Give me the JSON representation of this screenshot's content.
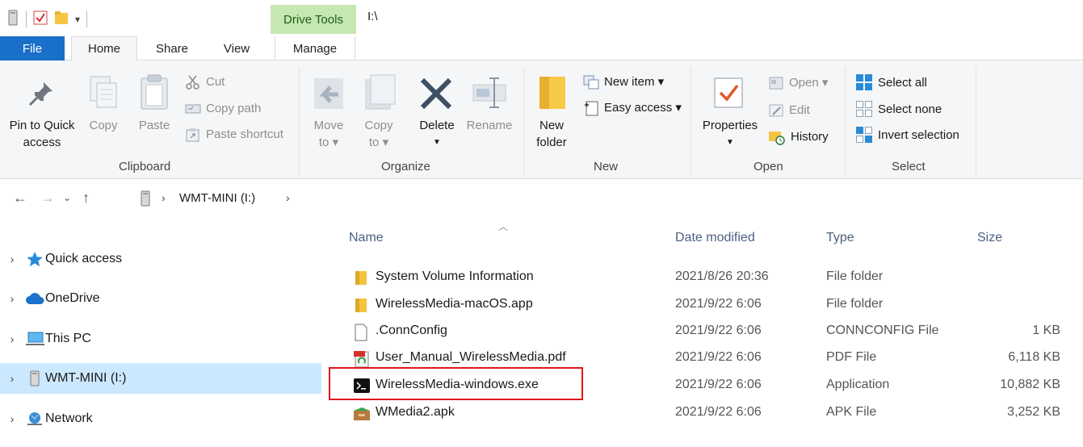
{
  "window": {
    "title": "I:\\",
    "context_tab": "Drive Tools"
  },
  "tabs": {
    "file": "File",
    "home": "Home",
    "share": "Share",
    "view": "View",
    "manage": "Manage"
  },
  "ribbon": {
    "clipboard": {
      "label": "Clipboard",
      "pin_line1": "Pin to Quick",
      "pin_line2": "access",
      "copy": "Copy",
      "paste": "Paste",
      "cut": "Cut",
      "copy_path": "Copy path",
      "paste_shortcut": "Paste shortcut"
    },
    "organize": {
      "label": "Organize",
      "move_to_line1": "Move",
      "move_to_line2": "to ▾",
      "copy_to_line1": "Copy",
      "copy_to_line2": "to ▾",
      "delete": "Delete",
      "rename": "Rename"
    },
    "new": {
      "label": "New",
      "new_folder_line1": "New",
      "new_folder_line2": "folder",
      "new_item": "New item ▾",
      "easy_access": "Easy access ▾"
    },
    "open": {
      "label": "Open",
      "properties": "Properties",
      "open": "Open ▾",
      "edit": "Edit",
      "history": "History"
    },
    "select": {
      "label": "Select",
      "select_all": "Select all",
      "select_none": "Select none",
      "invert_selection": "Invert selection"
    }
  },
  "address": {
    "location": "WMT-MINI (I:)"
  },
  "nav_pane": {
    "items": [
      {
        "label": "Quick access",
        "icon": "star-icon"
      },
      {
        "label": "OneDrive",
        "icon": "cloud-icon"
      },
      {
        "label": "This PC",
        "icon": "computer-icon"
      },
      {
        "label": "WMT-MINI (I:)",
        "icon": "drive-icon",
        "selected": true
      },
      {
        "label": "Network",
        "icon": "network-icon"
      }
    ]
  },
  "file_list": {
    "columns": {
      "name": "Name",
      "date": "Date modified",
      "type": "Type",
      "size": "Size"
    },
    "rows": [
      {
        "name": "System Volume Information",
        "date": "2021/8/26 20:36",
        "type": "File folder",
        "size": "",
        "icon": "folder-icon"
      },
      {
        "name": "WirelessMedia-macOS.app",
        "date": "2021/9/22 6:06",
        "type": "File folder",
        "size": "",
        "icon": "folder-icon"
      },
      {
        "name": ".ConnConfig",
        "date": "2021/9/22 6:06",
        "type": "CONNCONFIG File",
        "size": "1 KB",
        "icon": "file-icon"
      },
      {
        "name": "User_Manual_WirelessMedia.pdf",
        "date": "2021/9/22 6:06",
        "type": "PDF File",
        "size": "6,118 KB",
        "icon": "pdf-icon"
      },
      {
        "name": "WirelessMedia-windows.exe",
        "date": "2021/9/22 6:06",
        "type": "Application",
        "size": "10,882 KB",
        "icon": "exe-icon"
      },
      {
        "name": "WMedia2.apk",
        "date": "2021/9/22 6:06",
        "type": "APK File",
        "size": "3,252 KB",
        "icon": "apk-icon"
      }
    ]
  },
  "colors": {
    "accent": "#1a6fc9",
    "selected_bg": "#cce8ff",
    "drive_tools_bg": "#c7e7b0",
    "highlight_border": "#e0151b"
  }
}
